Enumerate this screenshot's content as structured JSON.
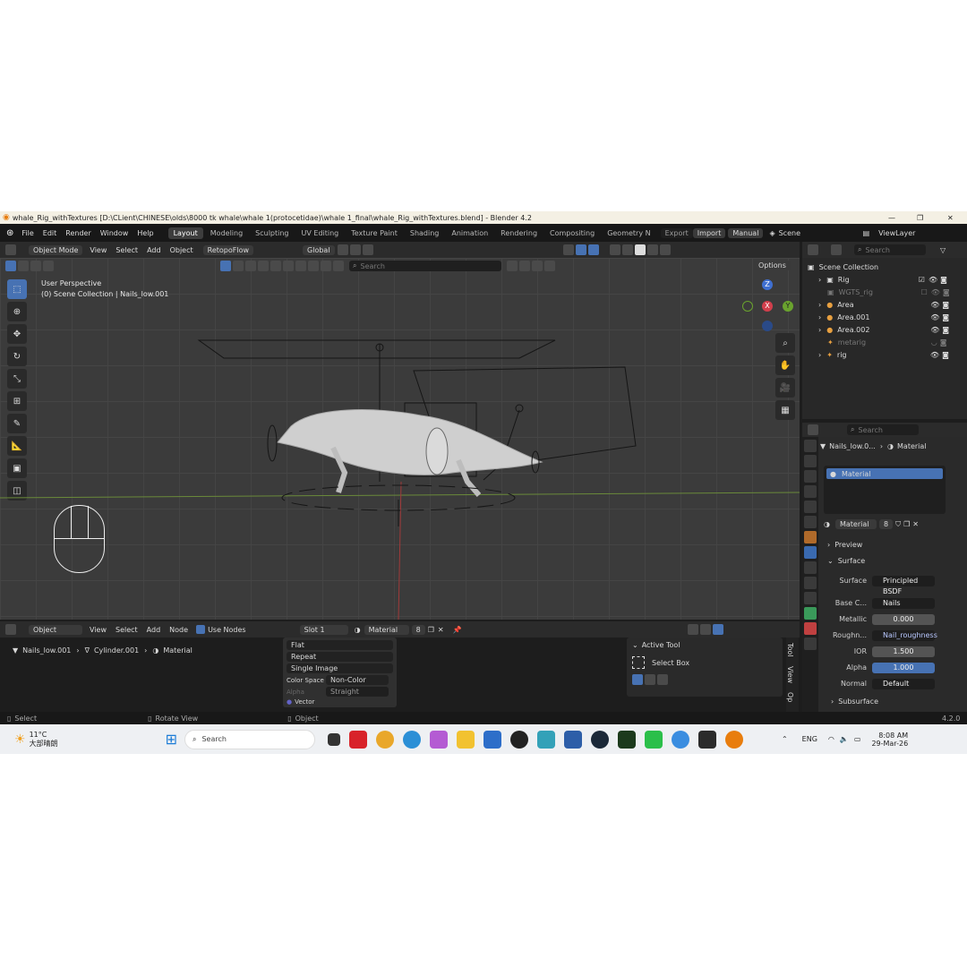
{
  "window": {
    "title": "whale_Rig_withTextures [D:\\CLient\\CHINESE\\olds\\8000 tk whale\\whale 1(protocetidae)\\whale 1_final\\whale_Rig_withTextures.blend] - Blender 4.2",
    "min": "—",
    "max": "❐",
    "close": "✕"
  },
  "menubar": {
    "items": [
      "File",
      "Edit",
      "Render",
      "Window",
      "Help"
    ],
    "workspaces": [
      "Layout",
      "Modeling",
      "Sculpting",
      "UV Editing",
      "Texture Paint",
      "Shading",
      "Animation",
      "Rendering",
      "Compositing",
      "Geometry N"
    ],
    "export": "Export",
    "import": "Import",
    "manual": "Manual",
    "scene": "Scene",
    "viewlayer": "ViewLayer"
  },
  "viewport_header": {
    "mode": "Object Mode",
    "menus": [
      "View",
      "Select",
      "Add",
      "Object"
    ],
    "retopoflow": "RetopoFlow",
    "orientation": "Global",
    "search_placeholder": "Search",
    "options": "Options"
  },
  "viewport": {
    "perspective": "User Perspective",
    "collection": "(0) Scene Collection | Nails_low.001",
    "gizmo_z": "Z",
    "gizmo_x": "X",
    "gizmo_y": "Y"
  },
  "outliner": {
    "search_placeholder": "Search",
    "root": "Scene Collection",
    "items": [
      {
        "label": "Rig",
        "dim": false
      },
      {
        "label": "WGTS_rig",
        "dim": true
      },
      {
        "label": "Area",
        "dim": false
      },
      {
        "label": "Area.001",
        "dim": false
      },
      {
        "label": "Area.002",
        "dim": false
      },
      {
        "label": "metarig",
        "dim": true
      },
      {
        "label": "rig",
        "dim": false
      }
    ]
  },
  "properties": {
    "search_placeholder": "Search",
    "breadcrumb_object": "Nails_low.0...",
    "breadcrumb_material": "Material",
    "slot_name": "Material",
    "material_name": "Material",
    "material_users": "8",
    "preview": "Preview",
    "surface_section": "Surface",
    "rows": [
      {
        "label": "Surface",
        "value": "Principled BSDF",
        "style": "dark"
      },
      {
        "label": "Base C...",
        "value": "Nails",
        "style": "dark"
      },
      {
        "label": "Metallic",
        "value": "0.000",
        "style": "grey"
      },
      {
        "label": "Roughn...",
        "value": "Nail_roughness",
        "style": "dark"
      },
      {
        "label": "IOR",
        "value": "1.500",
        "style": "grey"
      },
      {
        "label": "Alpha",
        "value": "1.000",
        "style": "blue"
      },
      {
        "label": "Normal",
        "value": "Default",
        "style": "dark"
      }
    ],
    "subsurface": "Subsurface"
  },
  "node_editor": {
    "object_type": "Object",
    "menus": [
      "View",
      "Select",
      "Add",
      "Node"
    ],
    "use_nodes": "Use Nodes",
    "slot": "Slot 1",
    "material": "Material",
    "material_users": "8",
    "breadcrumb": [
      "Nails_low.001",
      "Cylinder.001",
      "Material"
    ],
    "image_node": {
      "interpolation": "Flat",
      "extension": "Repeat",
      "source": "Single Image",
      "color_space_label": "Color Space",
      "color_space": "Non-Color",
      "alpha_label": "Alpha",
      "alpha": "Straight",
      "vector": "Vector"
    },
    "active_tool_title": "Active Tool",
    "active_tool": "Select Box",
    "side_tabs": [
      "Tool",
      "View",
      "Op"
    ]
  },
  "statusbar": {
    "select": "Select",
    "rotate": "Rotate View",
    "object": "Object",
    "version": "4.2.0"
  },
  "taskbar": {
    "weather_temp": "11°C",
    "weather_desc": "大部晴朗",
    "search_placeholder": "Search",
    "lang": "ENG",
    "time": "8:08 AM",
    "date": "29-Mar-26"
  },
  "colors": {
    "accent": "#4772b3",
    "background": "#1d1d1d",
    "viewport": "#3b3b3b"
  }
}
